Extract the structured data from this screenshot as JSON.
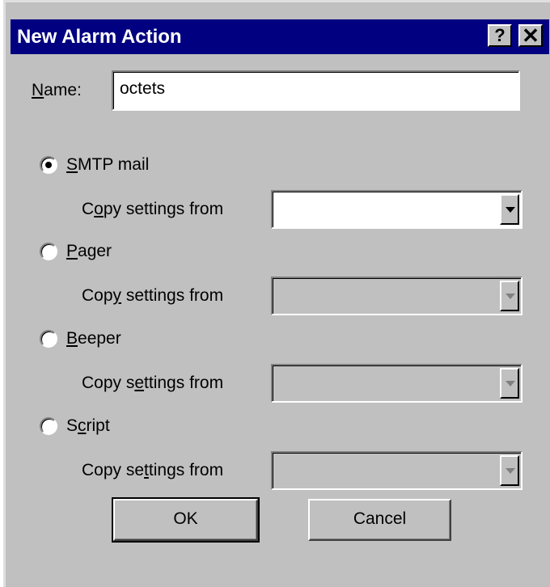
{
  "dialog": {
    "title": "New Alarm Action",
    "help_glyph": "?",
    "close_glyph": "✕"
  },
  "name_field": {
    "label_prefix": "",
    "label_accel": "N",
    "label_rest": "ame:",
    "value": "octets"
  },
  "actions": [
    {
      "label_prefix": "",
      "label_accel": "S",
      "label_rest": "MTP mail",
      "selected": true,
      "copy_prefix": "C",
      "copy_accel": "o",
      "copy_rest": "py settings from",
      "combo_enabled": true
    },
    {
      "label_prefix": "",
      "label_accel": "P",
      "label_rest": "ager",
      "selected": false,
      "copy_prefix": "Cop",
      "copy_accel": "y",
      "copy_rest": " settings from",
      "combo_enabled": false
    },
    {
      "label_prefix": "",
      "label_accel": "B",
      "label_rest": "eeper",
      "selected": false,
      "copy_prefix": "Copy s",
      "copy_accel": "e",
      "copy_rest": "ttings from",
      "combo_enabled": false
    },
    {
      "label_prefix": "S",
      "label_accel": "c",
      "label_rest": "ript",
      "selected": false,
      "copy_prefix": "Copy se",
      "copy_accel": "t",
      "copy_rest": "tings from",
      "combo_enabled": false
    }
  ],
  "buttons": {
    "ok": "OK",
    "cancel": "Cancel"
  },
  "colors": {
    "titlebar": "#000080",
    "face": "#c0c0c0"
  }
}
